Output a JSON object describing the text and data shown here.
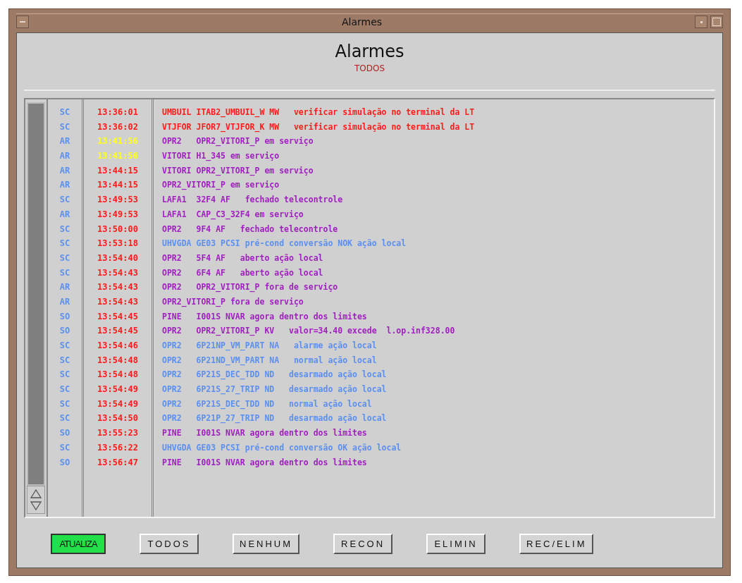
{
  "window": {
    "title": "Alarmes"
  },
  "header": {
    "title": "Alarmes",
    "subtitle": "TODOS"
  },
  "alarms": [
    {
      "code": "SC",
      "time": {
        "text": "13:36:01",
        "color": "#ff1a1a"
      },
      "message": {
        "text": "UMBUIL ITAB2_UMBUIL_W MW   verificar simulação no terminal da LT",
        "color": "#ff1a1a"
      }
    },
    {
      "code": "SC",
      "time": {
        "text": "13:36:02",
        "color": "#ff1a1a"
      },
      "message": {
        "text": "VTJFOR JFOR7_VTJFOR_K MW   verificar simulação no terminal da LT",
        "color": "#ff1a1a"
      }
    },
    {
      "code": "AR",
      "time": {
        "text": "13:41:56",
        "color": "#ffff1a"
      },
      "message": {
        "text": "OPR2   OPR2_VITORI_P em serviço",
        "color": "#a020c0"
      }
    },
    {
      "code": "AR",
      "time": {
        "text": "13:41:56",
        "color": "#ffff1a"
      },
      "message": {
        "text": "VITORI H1_345 em serviço",
        "color": "#a020c0"
      }
    },
    {
      "code": "AR",
      "time": {
        "text": "13:44:15",
        "color": "#ff1a1a"
      },
      "message": {
        "text": "VITORI OPR2_VITORI_P em serviço",
        "color": "#a020c0"
      }
    },
    {
      "code": "AR",
      "time": {
        "text": "13:44:15",
        "color": "#ff1a1a"
      },
      "message": {
        "text": "OPR2_VITORI_P em serviço",
        "color": "#a020c0"
      }
    },
    {
      "code": "SC",
      "time": {
        "text": "13:49:53",
        "color": "#ff1a1a"
      },
      "message": {
        "text": "LAFA1  32F4 AF   fechado telecontrole",
        "color": "#a020c0"
      }
    },
    {
      "code": "AR",
      "time": {
        "text": "13:49:53",
        "color": "#ff1a1a"
      },
      "message": {
        "text": "LAFA1  CAP_C3_32F4 em serviço",
        "color": "#a020c0"
      }
    },
    {
      "code": "SC",
      "time": {
        "text": "13:50:00",
        "color": "#ff1a1a"
      },
      "message": {
        "text": "OPR2   9F4 AF   fechado telecontrole",
        "color": "#a020c0"
      }
    },
    {
      "code": "SC",
      "time": {
        "text": "13:53:18",
        "color": "#ff1a1a"
      },
      "message": {
        "text": "UHVGDA GE03 PCSI pré-cond conversão NOK ação local",
        "color": "#5b8ff0"
      }
    },
    {
      "code": "SC",
      "time": {
        "text": "13:54:40",
        "color": "#ff1a1a"
      },
      "message": {
        "text": "OPR2   5F4 AF   aberto ação local",
        "color": "#a020c0"
      }
    },
    {
      "code": "SC",
      "time": {
        "text": "13:54:43",
        "color": "#ff1a1a"
      },
      "message": {
        "text": "OPR2   6F4 AF   aberto ação local",
        "color": "#a020c0"
      }
    },
    {
      "code": "AR",
      "time": {
        "text": "13:54:43",
        "color": "#ff1a1a"
      },
      "message": {
        "text": "OPR2   OPR2_VITORI_P fora de serviço",
        "color": "#a020c0"
      }
    },
    {
      "code": "AR",
      "time": {
        "text": "13:54:43",
        "color": "#ff1a1a"
      },
      "message": {
        "text": "OPR2_VITORI_P fora de serviço",
        "color": "#a020c0"
      }
    },
    {
      "code": "SO",
      "time": {
        "text": "13:54:45",
        "color": "#ff1a1a"
      },
      "message": {
        "text": "PINE   I001S NVAR agora dentro dos limites",
        "color": "#a020c0"
      }
    },
    {
      "code": "SO",
      "time": {
        "text": "13:54:45",
        "color": "#ff1a1a"
      },
      "message": {
        "text": "OPR2   OPR2_VITORI_P KV   valor=34.40 excede  l.op.inf328.00",
        "color": "#a020c0"
      }
    },
    {
      "code": "SC",
      "time": {
        "text": "13:54:46",
        "color": "#ff1a1a"
      },
      "message": {
        "text": "OPR2   6P21NP_VM_PART NA   alarme ação local",
        "color": "#5b8ff0"
      }
    },
    {
      "code": "SC",
      "time": {
        "text": "13:54:48",
        "color": "#ff1a1a"
      },
      "message": {
        "text": "OPR2   6P21ND_VM_PART NA   normal ação local",
        "color": "#5b8ff0"
      }
    },
    {
      "code": "SC",
      "time": {
        "text": "13:54:48",
        "color": "#ff1a1a"
      },
      "message": {
        "text": "OPR2   6P21S_DEC_TDD ND   desarmado ação local",
        "color": "#5b8ff0"
      }
    },
    {
      "code": "SC",
      "time": {
        "text": "13:54:49",
        "color": "#ff1a1a"
      },
      "message": {
        "text": "OPR2   6P21S_27_TRIP ND   desarmado ação local",
        "color": "#5b8ff0"
      }
    },
    {
      "code": "SC",
      "time": {
        "text": "13:54:49",
        "color": "#ff1a1a"
      },
      "message": {
        "text": "OPR2   6P21S_DEC_TDD ND   normal ação local",
        "color": "#5b8ff0"
      }
    },
    {
      "code": "SC",
      "time": {
        "text": "13:54:50",
        "color": "#ff1a1a"
      },
      "message": {
        "text": "OPR2   6P21P_27_TRIP ND   desarmado ação local",
        "color": "#5b8ff0"
      }
    },
    {
      "code": "SO",
      "time": {
        "text": "13:55:23",
        "color": "#ff1a1a"
      },
      "message": {
        "text": "PINE   I001S NVAR agora dentro dos limites",
        "color": "#a020c0"
      }
    },
    {
      "code": "SC",
      "time": {
        "text": "13:56:22",
        "color": "#ff1a1a"
      },
      "message": {
        "text": "UHVGDA GE03 PCSI pré-cond conversão OK ação local",
        "color": "#5b8ff0"
      }
    },
    {
      "code": "SO",
      "time": {
        "text": "13:56:47",
        "color": "#ff1a1a"
      },
      "message": {
        "text": "PINE   I001S NVAR agora dentro dos limites",
        "color": "#a020c0"
      }
    }
  ],
  "buttons": [
    {
      "label": "ATUALIZA",
      "selected": true
    },
    {
      "label": "TODOS",
      "selected": false
    },
    {
      "label": "NENHUM",
      "selected": false
    },
    {
      "label": "RECON",
      "selected": false
    },
    {
      "label": "ELIMIN",
      "selected": false
    },
    {
      "label": "REC/ELIM",
      "selected": false
    }
  ]
}
